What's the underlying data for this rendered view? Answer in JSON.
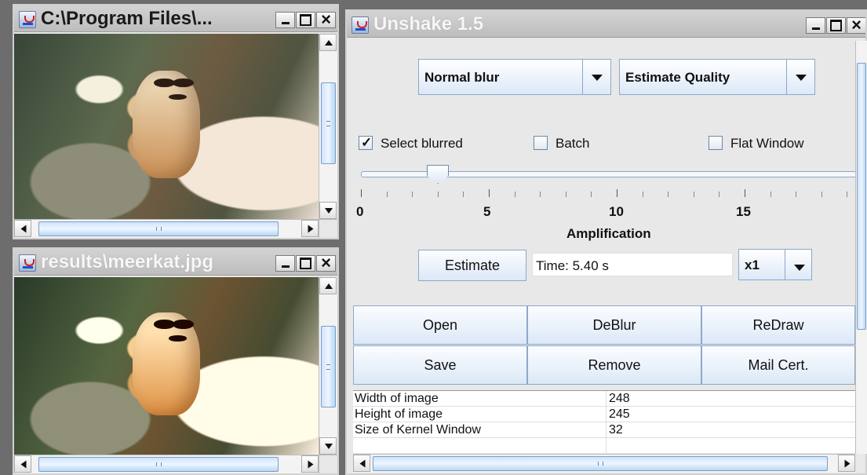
{
  "windows": {
    "original": {
      "title": "C:\\Program Files\\..."
    },
    "result": {
      "title": "results\\meerkat.jpg"
    },
    "main": {
      "title": "Unshake 1.5"
    }
  },
  "controls": {
    "blur_type": "Normal blur",
    "quality_mode": "Estimate Quality",
    "select_blurred": "Select blurred",
    "batch": "Batch",
    "flat_window": "Flat Window",
    "slider": {
      "min": 0,
      "max": 15,
      "value": 3,
      "ticks": [
        "0",
        "5",
        "10",
        "15"
      ],
      "label": "Amplification"
    },
    "estimate": "Estimate",
    "time": "Time: 5.40 s",
    "zoom": "x1"
  },
  "buttons": {
    "open": "Open",
    "deblur": "DeBlur",
    "redraw": "ReDraw",
    "save": "Save",
    "remove": "Remove",
    "mail_cert": "Mail Cert."
  },
  "table": {
    "rows": [
      {
        "label": "Width of image",
        "value": "248"
      },
      {
        "label": "Height of image",
        "value": "245"
      },
      {
        "label": "Size of Kernel Window",
        "value": "32"
      }
    ]
  },
  "colors": {
    "desktop": "#6d6d6d",
    "titlebar": "#c8c8c8",
    "button": "#dce8f7",
    "border": "#8da8ca"
  },
  "icons": [
    "java-app-icon",
    "minimize-icon",
    "maximize-icon",
    "close-icon",
    "dropdown-arrow-icon",
    "scroll-arrow-icon"
  ]
}
